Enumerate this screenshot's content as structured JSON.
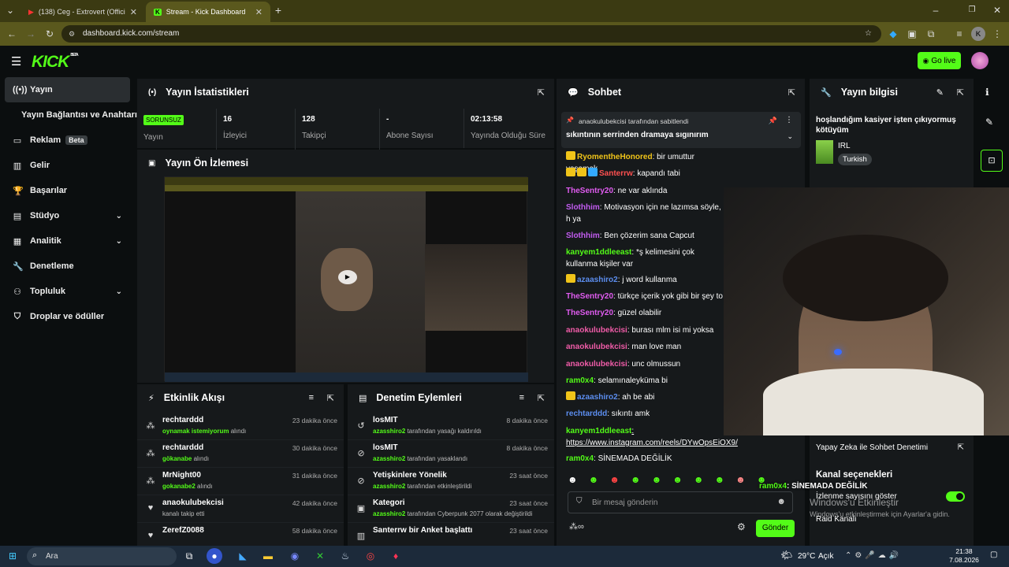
{
  "browser": {
    "tabs": [
      {
        "label": "(138) Ceg - Extrovert (Official V..."
      },
      {
        "label": "Stream - Kick Dashboard"
      }
    ],
    "url": "dashboard.kick.com/stream",
    "profile_initial": "K"
  },
  "header": {
    "logo": "KICK",
    "logo_badge": "BETA",
    "go_live": "Go live"
  },
  "sidebar": {
    "items": [
      {
        "label": "Yayın",
        "icon": "broadcast-icon"
      },
      {
        "label": "Yayın Bağlantısı ve Anahtarı",
        "icon": ""
      },
      {
        "label": "Reklam",
        "icon": "ad-icon",
        "badge": "Beta"
      },
      {
        "label": "Gelir",
        "icon": "chart-icon"
      },
      {
        "label": "Başarılar",
        "icon": "trophy-icon"
      },
      {
        "label": "Stüdyo",
        "icon": "studio-icon"
      },
      {
        "label": "Analitik",
        "icon": "analytics-icon"
      },
      {
        "label": "Denetleme",
        "icon": "wrench-icon"
      },
      {
        "label": "Topluluk",
        "icon": "community-icon"
      },
      {
        "label": "Droplar ve ödüller",
        "icon": "drops-icon"
      }
    ]
  },
  "stats": {
    "title": "Yayın İstatistikleri",
    "status": "SORUNSUZ",
    "status_label": "Yayın",
    "viewers": "16",
    "viewers_label": "İzleyici",
    "followers": "128",
    "followers_label": "Takipçi",
    "subs": "-",
    "subs_label": "Abone Sayısı",
    "uptime": "02:13:58",
    "uptime_label": "Yayında Olduğu Süre"
  },
  "preview": {
    "title": "Yayın Ön İzlemesi"
  },
  "events": {
    "title": "Etkinlik Akışı",
    "items": [
      {
        "name": "rechtarddd",
        "highlight": "oynamak istemiyorum",
        "rest": " alındı",
        "time": "23 dakika önce"
      },
      {
        "name": "rechtarddd",
        "highlight": "gökanabe",
        "rest": " alındı",
        "time": "30 dakika önce"
      },
      {
        "name": "MrNight00",
        "highlight": "gokanabe2",
        "rest": " alındı",
        "time": "31 dakika önce"
      },
      {
        "name": "anaokulubekcisi",
        "highlight": "",
        "rest": "kanalı takip etti",
        "time": "42 dakika önce"
      },
      {
        "name": "ZerefZ0088",
        "highlight": "",
        "rest": "",
        "time": "58 dakika önce"
      }
    ]
  },
  "moderation": {
    "title": "Denetim Eylemleri",
    "items": [
      {
        "name": "losMIT",
        "highlight": "azasshiro2",
        "rest": " tarafından yasağı kaldırıldı",
        "time": "8 dakika önce"
      },
      {
        "name": "losMIT",
        "highlight": "azasshiro2",
        "rest": " tarafından yasaklandı",
        "time": "8 dakika önce"
      },
      {
        "name": "Yetişkinlere Yönelik",
        "highlight": "azasshiro2",
        "rest": " tarafından etkinleştirildi",
        "time": "23 saat önce"
      },
      {
        "name": "Kategori",
        "highlight": "azasshiro2",
        "rest": " tarafından Cyberpunk 2077 olarak değiştirildi",
        "time": "23 saat önce"
      },
      {
        "name": "Santerrw bir Anket başlattı",
        "highlight": "",
        "rest": "",
        "time": "23 saat önce"
      }
    ]
  },
  "chat": {
    "title": "Sohbet",
    "pinned_by": "anaokulubekcisi tarafından sabitlendi",
    "pinned_text": "sıkıntının serrinden dramaya sıgınırım",
    "messages": [
      {
        "user": "RyomentheHonored",
        "color": "#f0c419",
        "text": ": bir umuttur yaşamak"
      },
      {
        "user": "Santerrw",
        "color": "#ff5050",
        "text": ": kapandı tabi"
      },
      {
        "user": "TheSentry20",
        "color": "#e05cf0",
        "text": ": ne var aklında"
      },
      {
        "user": "Slothhim",
        "color": "#c25cf0",
        "text": ": Motivasyon için ne lazımsa söyle, h ya"
      },
      {
        "user": "Slothhim",
        "color": "#c25cf0",
        "text": ": Ben çözerim sana Capcut"
      },
      {
        "user": "kanyem1ddleeast",
        "color": "#53fc18",
        "text": ": *ş kelimesini çok kullanma kişiler var"
      },
      {
        "user": "azaashiro2",
        "color": "#5c8ef0",
        "text": ": j word kullanma"
      },
      {
        "user": "TheSentry20",
        "color": "#e05cf0",
        "text": ": türkçe içerik yok gibi bir şey to"
      },
      {
        "user": "TheSentry20",
        "color": "#e05cf0",
        "text": ": güzel olabilir"
      },
      {
        "user": "anaokulubekcisi",
        "color": "#f05ca8",
        "text": ": burası mlm isi mi yoksa"
      },
      {
        "user": "anaokulubekcisi",
        "color": "#f05ca8",
        "text": ": man love man"
      },
      {
        "user": "anaokulubekcisi",
        "color": "#f05ca8",
        "text": ": unc olmussun"
      },
      {
        "user": "ram0x4",
        "color": "#53fc18",
        "text": ": selamınaleyküma bi"
      },
      {
        "user": "azaashiro2",
        "color": "#5c8ef0",
        "text": ": ah be abi"
      },
      {
        "user": "rechtarddd",
        "color": "#5c8ef0",
        "text": ": sıkıntı amk"
      },
      {
        "user": "kanyem1ddleeast",
        "color": "#53fc18",
        "text": ": https://www.instagram.com/reels/DYwOpsEiOX9/"
      },
      {
        "user": "ram0x4",
        "color": "#53fc18",
        "text": ": SİNEMADA DEĞİLİK"
      }
    ],
    "input_placeholder": "Bir mesaj gönderin",
    "send": "Gönder"
  },
  "info": {
    "title": "Yayın bilgisi",
    "stream_title": "hoşlandığım kasiyer işten çıkıyormuş kötüyüm",
    "category": "IRL",
    "language": "Turkish",
    "ai_mod": "Yapay Zeka ile Sohbet Denetimi",
    "channel_options": "Kanal seçenekleri",
    "show_viewers": "İzlenme sayısını göster",
    "raid": "Raid Kanalı"
  },
  "overlay": {
    "user": "ram0x4",
    "text": ": SİNEMADA DEĞİLİK",
    "win_activate": "Windows'u Etkinleştir",
    "win_activate_sub": "Windows'u etkinleştirmek için Ayarlar'a gidin."
  },
  "taskbar": {
    "search": "Ara",
    "weather": "29°C",
    "weather_text": "Açık",
    "time": "21:38",
    "date": "7.08.2026"
  }
}
